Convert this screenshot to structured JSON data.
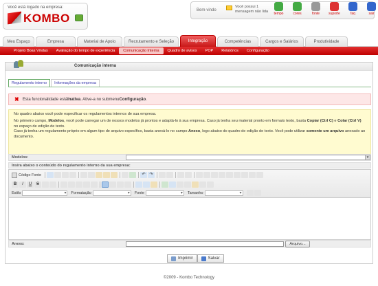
{
  "header": {
    "logged_in_text": "Você está logado na empresa:",
    "logo_text": "KOMBO",
    "welcome": "Bem-vindo",
    "messages_text": "Você possui 1 mensagem não lida",
    "icons": [
      {
        "name": "tempo",
        "label": "tempo",
        "icon": "clock-icon"
      },
      {
        "name": "cores",
        "label": "cores",
        "icon": "palette-icon"
      },
      {
        "name": "fonte",
        "label": "fonte",
        "icon": "font-icon"
      },
      {
        "name": "suporte",
        "label": "suporte",
        "icon": "support-icon"
      },
      {
        "name": "faq",
        "label": "faq",
        "icon": "faq-icon"
      },
      {
        "name": "sair",
        "label": "sair",
        "icon": "exit-icon"
      }
    ]
  },
  "mainnav": [
    "Meu Espaço",
    "Empresa",
    "Material de Apoio",
    "Recrutamento e Seleção",
    "Integração",
    "Competências",
    "Cargos e Salários",
    "Produtividade"
  ],
  "mainnav_active": "Integração",
  "subnav": [
    "Projeto Boas Vindas",
    "Avaliação do tempo de experiência",
    "Comunicação Interna",
    "Quadro de avisos",
    "POP",
    "Relatórios",
    "Configuração"
  ],
  "subnav_active": "Comunicação Interna",
  "panel": {
    "title": "Comunicação interna",
    "tabs": [
      "Regulamento interno",
      "Informações da empresa"
    ],
    "alert": {
      "prefix": "Esta funcionalidade está ",
      "status": "Inativa",
      "middle": ". Ative-a no submenu ",
      "link": "Configuração",
      "suffix": "."
    },
    "info": {
      "p1": "No quadro abaixo você pode especificar os regulamentos internos de sua empresa.",
      "p2a": "No primeiro campo, ",
      "p2b": "Modelos",
      "p2c": ", você pode carregar um de nossos modelos já prontos e adaptá-lo à sua empresa. Caso já tenha seu material pronto em formato texto, basta ",
      "p2d": "Copiar (Ctrl C)",
      "p2e": " e ",
      "p2f": "Colar (Ctrl V)",
      "p2g": " no espaço de edição de texto.",
      "p3a": "Caso já tenha um regulamento próprio em algum tipo de arquivo específico, basta anexá-lo no campo ",
      "p3b": "Anexo",
      "p3c": ", logo abaixo do quadro de edição de texto. Você pode utilizar ",
      "p3d": "somente um arquivo",
      "p3e": " anexado ao documento."
    },
    "models_label": "Modelos:",
    "insert_label": "Insira abaixo o conteúdo do regulamento interno da sua empresa:",
    "toolbar": {
      "source_label": "Código Fonte",
      "style_label": "Estilo",
      "format_label": "Formatação",
      "font_label": "Fonte",
      "size_label": "Tamanho",
      "bold": "B",
      "italic": "I",
      "underline": "U",
      "strike": "S"
    },
    "attach_label": "Anexo:",
    "file_button": "Arquivo...",
    "print_button": "Imprimir",
    "save_button": "Salvar"
  },
  "footer": "©2009 - Kombo Technology"
}
